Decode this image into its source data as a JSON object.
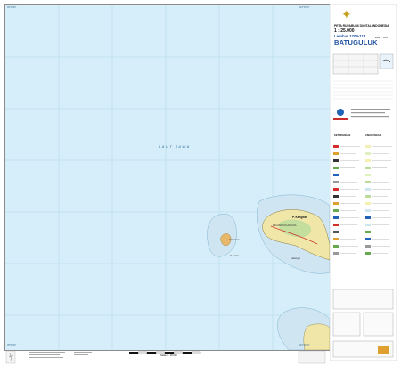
{
  "map": {
    "sea_label": "LAUT JAWA",
    "island_name": "P. Kangean",
    "places": [
      "Kelurahan",
      "KECAMATAN ARJASA",
      "P. Saobi",
      "Kalianget"
    ],
    "corner_labels": [
      "05°40'00\"",
      "115°15'00\"",
      "115°30'00\"",
      "05°55'00\""
    ],
    "sea_color": "#d6eef9",
    "land_color": "#f0e6a8",
    "reef_color": "#d9ecf5"
  },
  "header": {
    "series_title": "PETA RUPABUMI DIGITAL INDONESIA",
    "scale": "1 : 25.000",
    "sheet_number": "Lembar 1709-114",
    "sheet_name": "BATUGULUK",
    "edition": "Edisi I - 1999"
  },
  "legend": {
    "heading": "KETERANGAN",
    "right_heading": "LINGKUNGAN"
  },
  "footer": {
    "scale_bar_label": "Skala 1 : 25.000"
  }
}
